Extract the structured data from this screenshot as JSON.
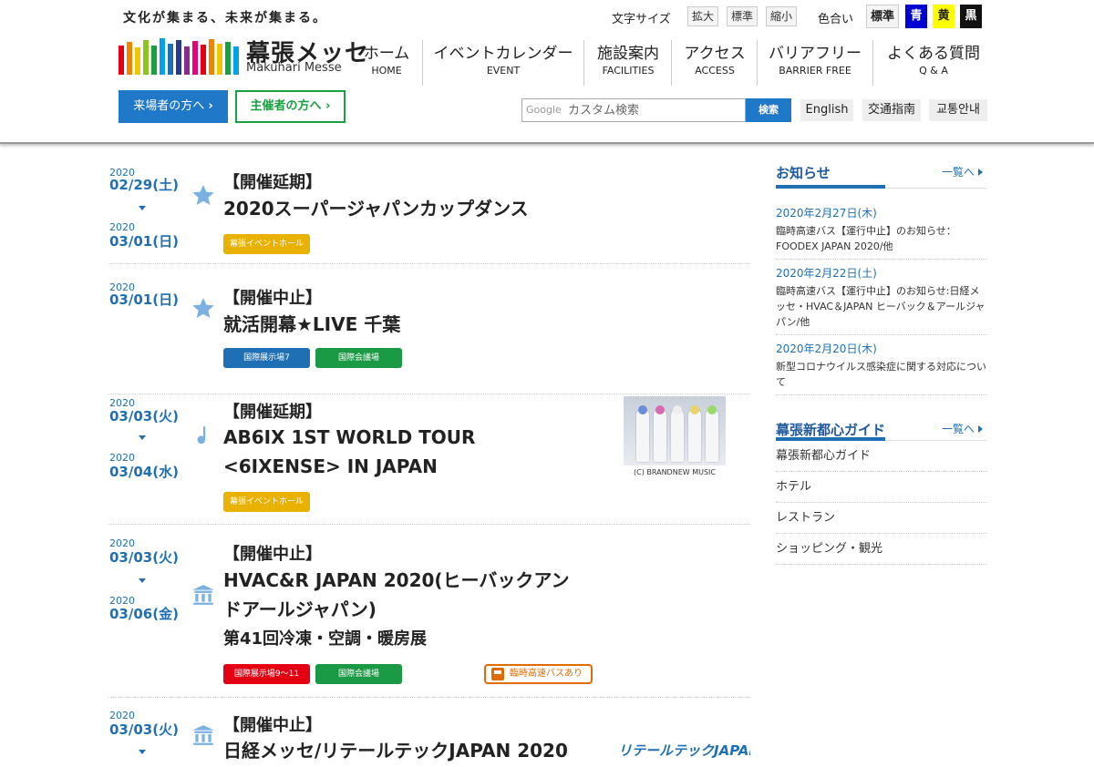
{
  "header": {
    "tagline": "文化が集まる、未来が集まる。",
    "logo_jp": "幕張メッセ",
    "logo_en": "Makuhari Messe",
    "font_size_label": "文字サイズ",
    "font_buttons": [
      "拡大",
      "標準",
      "縮小"
    ],
    "color_label": "色合い",
    "color_buttons": [
      "標準",
      "青",
      "黄",
      "黒"
    ],
    "nav": [
      {
        "jp": "ホーム",
        "en": "HOME"
      },
      {
        "jp": "イベントカレンダー",
        "en": "EVENT"
      },
      {
        "jp": "施設案内",
        "en": "FACILITIES"
      },
      {
        "jp": "アクセス",
        "en": "ACCESS"
      },
      {
        "jp": "バリアフリー",
        "en": "BARRIER FREE"
      },
      {
        "jp": "よくある質問",
        "en": "Q & A"
      }
    ],
    "visitor_button": "来場者の方へ",
    "organizer_button": "主催者の方へ",
    "search_brand": "Google",
    "search_placeholder": "カスタム検索",
    "search_button": "検索",
    "lang_buttons": [
      "English",
      "交通指南",
      "교통안내"
    ]
  },
  "events": [
    {
      "start_year": "2020",
      "start_date": "02/29(土)",
      "end_year": "2020",
      "end_date": "03/01(日)",
      "icon": "star-icon",
      "status": "【開催延期】",
      "title": [
        "2020スーパージャパンカップダンス"
      ],
      "tags": [
        "幕張イベントホール"
      ]
    },
    {
      "start_year": "2020",
      "start_date": "03/01(日)",
      "icon": "star-icon",
      "status": "【開催中止】",
      "title": [
        "就活開幕★LIVE 千葉"
      ],
      "tags": [
        "国際展示場7",
        "国際会議場"
      ]
    },
    {
      "start_year": "2020",
      "start_date": "03/03(火)",
      "end_year": "2020",
      "end_date": "03/04(水)",
      "icon": "music-note-icon",
      "status": "【開催延期】",
      "title": [
        "AB6IX 1ST WORLD TOUR",
        "<6IXENSE> IN JAPAN"
      ],
      "tags": [
        "幕張イベントホール"
      ],
      "photo_credit": "(C) BRANDNEW MUSIC"
    },
    {
      "start_year": "2020",
      "start_date": "03/03(火)",
      "end_year": "2020",
      "end_date": "03/06(金)",
      "icon": "building-icon",
      "status": "【開催中止】",
      "title": [
        "HVAC&R JAPAN 2020(ヒーバックアン",
        "ドアールジャパン)",
        "第41回冷凍・空調・暖房展"
      ],
      "tags": [
        "国際展示場9～11",
        "国際会議場"
      ],
      "bus_badge": "臨時高速バスあり"
    },
    {
      "start_year": "2020",
      "start_date": "03/03(火)",
      "icon": "building-icon",
      "status": "【開催中止】",
      "title": [
        "日経メッセ/リテールテックJAPAN 2020"
      ],
      "partner_logo": "リテールテックJAPAN"
    }
  ],
  "sidebar": {
    "news_title": "お知らせ",
    "more_label": "一覧へ",
    "news": [
      {
        "date": "2020年2月27日(木)",
        "text": "臨時高速バス【運行中止】のお知らせ：FOODEX JAPAN 2020/他"
      },
      {
        "date": "2020年2月22日(土)",
        "text": "臨時高速バス【運行中止】のお知らせ:日経メッセ・HVAC＆JAPAN ヒーバック＆アールジャパン/他"
      },
      {
        "date": "2020年2月20日(木)",
        "text": "新型コロナウイルス感染症に関する対応について"
      }
    ],
    "guide_title": "幕張新都心ガイド",
    "guide_items": [
      "幕張新都心ガイド",
      "ホテル",
      "レストラン",
      "ショッピング・観光"
    ]
  },
  "colors": {
    "accent": "#1f78c8",
    "organizer": "#1aa040",
    "date_blue": "#1f6fb5",
    "tag_yellow": "#e9b200",
    "tag_red": "#e40012",
    "bus_orange": "#e06b00"
  }
}
